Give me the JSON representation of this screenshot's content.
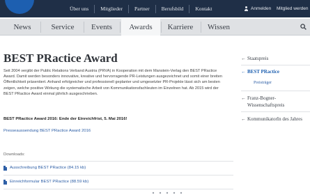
{
  "topnav": {
    "items": [
      "Über uns",
      "Mitglieder",
      "Partner",
      "Berufsbild",
      "Kontakt"
    ],
    "login": "Anmelden",
    "become_member": "Mitglied werden"
  },
  "mainnav": {
    "tabs": [
      "News",
      "Service",
      "Events",
      "Awards",
      "Karriere",
      "Wissen"
    ],
    "active_tab": "Awards"
  },
  "page": {
    "title": "BEST PRactice Award",
    "paragraph": "Seit 2004 vergibt der Public Relations Verband Austria (PRVA) in Kooperation mit dem Manstein-Verlag den BEST PRactice Award. Damit werden besonders innovative, kreative und hervorragende PR-Leistungen ausgezeichnet und somit einer breiten Öffentlichkeit präsentiert. Anhand erfolgreicher und professionell geplanter und umgesetzter PR-Projekte lässt sich am besten zeigen, welche positive Wirkung die systematische Arbeit von Kommunikationsfachleuten im Einzelnen hat. Ab 2015 wird der BEST PRactice Award einmal jährlich ausgeschrieben.",
    "deadline": "BEST PRactice Award 2016: Ende der Einreichfrist, 5. Mai 2016!",
    "press_link": "Presseaussendung BEST PRactice Award 2016",
    "downloads_label": "Downloads:",
    "downloads": [
      {
        "label": "Ausschreibung BEST PRactice (84.15 kb)"
      },
      {
        "label": "Einreichformular BEST PRactice (88.59 kb)"
      }
    ]
  },
  "sidebar": {
    "items": [
      {
        "label": "Staatspreis"
      },
      {
        "label": "BEST PRactice"
      },
      {
        "label": "Franz-Bogner-Wissenschaftspreis"
      },
      {
        "label": "KommunikatorIn des Jahres"
      }
    ],
    "sub_item": "Preisträger",
    "active_item": "BEST PRactice"
  },
  "colors": {
    "topbar": "#1f2f47",
    "logo": "#1d5fb0",
    "link": "#2e5fa6",
    "nav_bg": "#dfe1e4"
  }
}
